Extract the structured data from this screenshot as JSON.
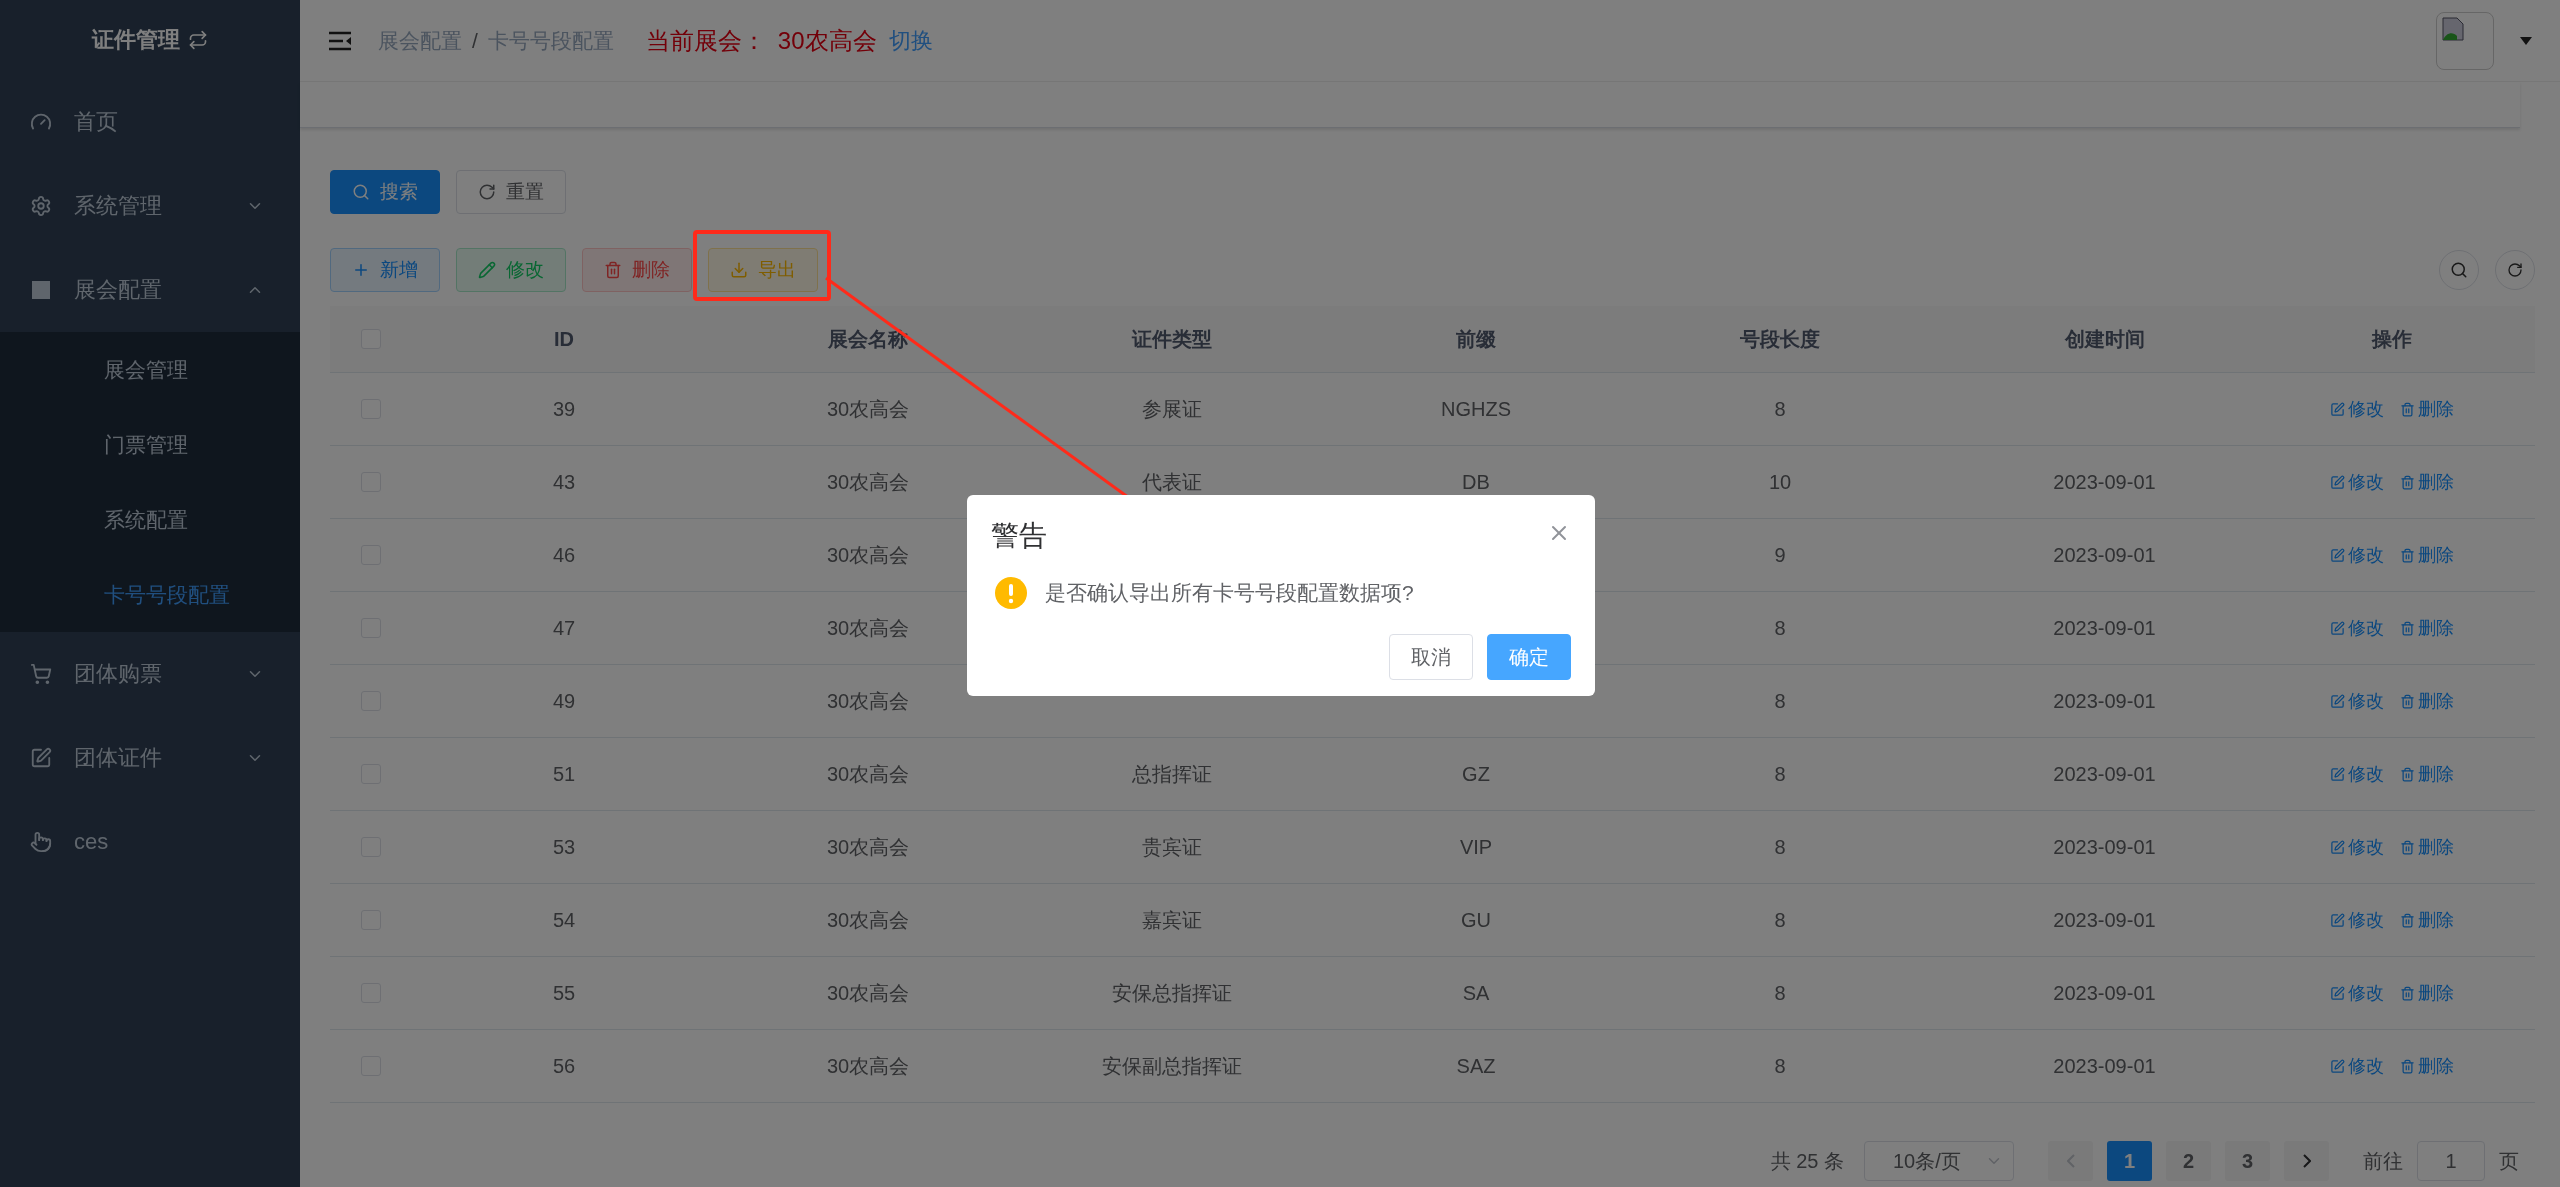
{
  "sidebar": {
    "title": "证件管理",
    "items": [
      {
        "label": "首页"
      },
      {
        "label": "系统管理",
        "expanded": false
      },
      {
        "label": "展会配置",
        "expanded": true,
        "children": [
          {
            "label": "展会管理",
            "selected": false
          },
          {
            "label": "门票管理",
            "selected": false
          },
          {
            "label": "系统配置",
            "selected": false
          },
          {
            "label": "卡号号段配置",
            "selected": true
          }
        ]
      },
      {
        "label": "团体购票",
        "expanded": false
      },
      {
        "label": "团体证件",
        "expanded": false
      },
      {
        "label": "ces"
      }
    ]
  },
  "header": {
    "breadcrumb": [
      "展会配置",
      "卡号号段配置"
    ],
    "breadcrumb_separator": "/",
    "current_label": "当前展会：",
    "current_value": "30农高会",
    "switch_link": "切换"
  },
  "search_buttons": [
    {
      "kind": "search",
      "label": "搜索"
    },
    {
      "kind": "reset",
      "label": "重置"
    }
  ],
  "toolbar": [
    {
      "kind": "add",
      "label": "新增",
      "highlighted": false
    },
    {
      "kind": "edit",
      "label": "修改",
      "highlighted": false
    },
    {
      "kind": "delete",
      "label": "删除",
      "highlighted": false
    },
    {
      "kind": "export",
      "label": "导出",
      "highlighted": true
    }
  ],
  "table": {
    "header_checked": false,
    "columns": [
      "ID",
      "展会名称",
      "证件类型",
      "前缀",
      "号段长度",
      "创建时间",
      "操作"
    ],
    "rows": [
      {
        "checked": false,
        "cells": [
          "39",
          "30农高会",
          "参展证",
          "NGHZS",
          "8",
          ""
        ],
        "actions": [
          "修改",
          "删除"
        ]
      },
      {
        "checked": false,
        "cells": [
          "43",
          "30农高会",
          "代表证",
          "DB",
          "10",
          "2023-09-01"
        ],
        "actions": [
          "修改",
          "删除"
        ]
      },
      {
        "checked": false,
        "cells": [
          "46",
          "30农高会",
          "",
          "",
          "9",
          "2023-09-01"
        ],
        "actions": [
          "修改",
          "删除"
        ]
      },
      {
        "checked": false,
        "cells": [
          "47",
          "30农高会",
          "",
          "",
          "8",
          "2023-09-01"
        ],
        "actions": [
          "修改",
          "删除"
        ]
      },
      {
        "checked": false,
        "cells": [
          "49",
          "30农高会",
          "",
          "",
          "8",
          "2023-09-01"
        ],
        "actions": [
          "修改",
          "删除"
        ]
      },
      {
        "checked": false,
        "cells": [
          "51",
          "30农高会",
          "总指挥证",
          "GZ",
          "8",
          "2023-09-01"
        ],
        "actions": [
          "修改",
          "删除"
        ]
      },
      {
        "checked": false,
        "cells": [
          "53",
          "30农高会",
          "贵宾证",
          "VIP",
          "8",
          "2023-09-01"
        ],
        "actions": [
          "修改",
          "删除"
        ]
      },
      {
        "checked": false,
        "cells": [
          "54",
          "30农高会",
          "嘉宾证",
          "GU",
          "8",
          "2023-09-01"
        ],
        "actions": [
          "修改",
          "删除"
        ]
      },
      {
        "checked": false,
        "cells": [
          "55",
          "30农高会",
          "安保总指挥证",
          "SA",
          "8",
          "2023-09-01"
        ],
        "actions": [
          "修改",
          "删除"
        ]
      },
      {
        "checked": false,
        "cells": [
          "56",
          "30农高会",
          "安保副总指挥证",
          "SAZ",
          "8",
          "2023-09-01"
        ],
        "actions": [
          "修改",
          "删除"
        ]
      }
    ]
  },
  "pagination": {
    "total": "共 25 条",
    "page_size": "10条/页",
    "pages": [
      {
        "label": "1",
        "selected": true
      },
      {
        "label": "2",
        "selected": false
      },
      {
        "label": "3",
        "selected": false
      }
    ],
    "goto_label": "前往",
    "goto_value": "1",
    "goto_suffix": "页"
  },
  "dialog": {
    "title": "警告",
    "message": "是否确认导出所有卡号号段配置数据项?",
    "buttons": [
      {
        "kind": "cancel",
        "label": "取消"
      },
      {
        "kind": "confirm",
        "label": "确定"
      }
    ]
  }
}
